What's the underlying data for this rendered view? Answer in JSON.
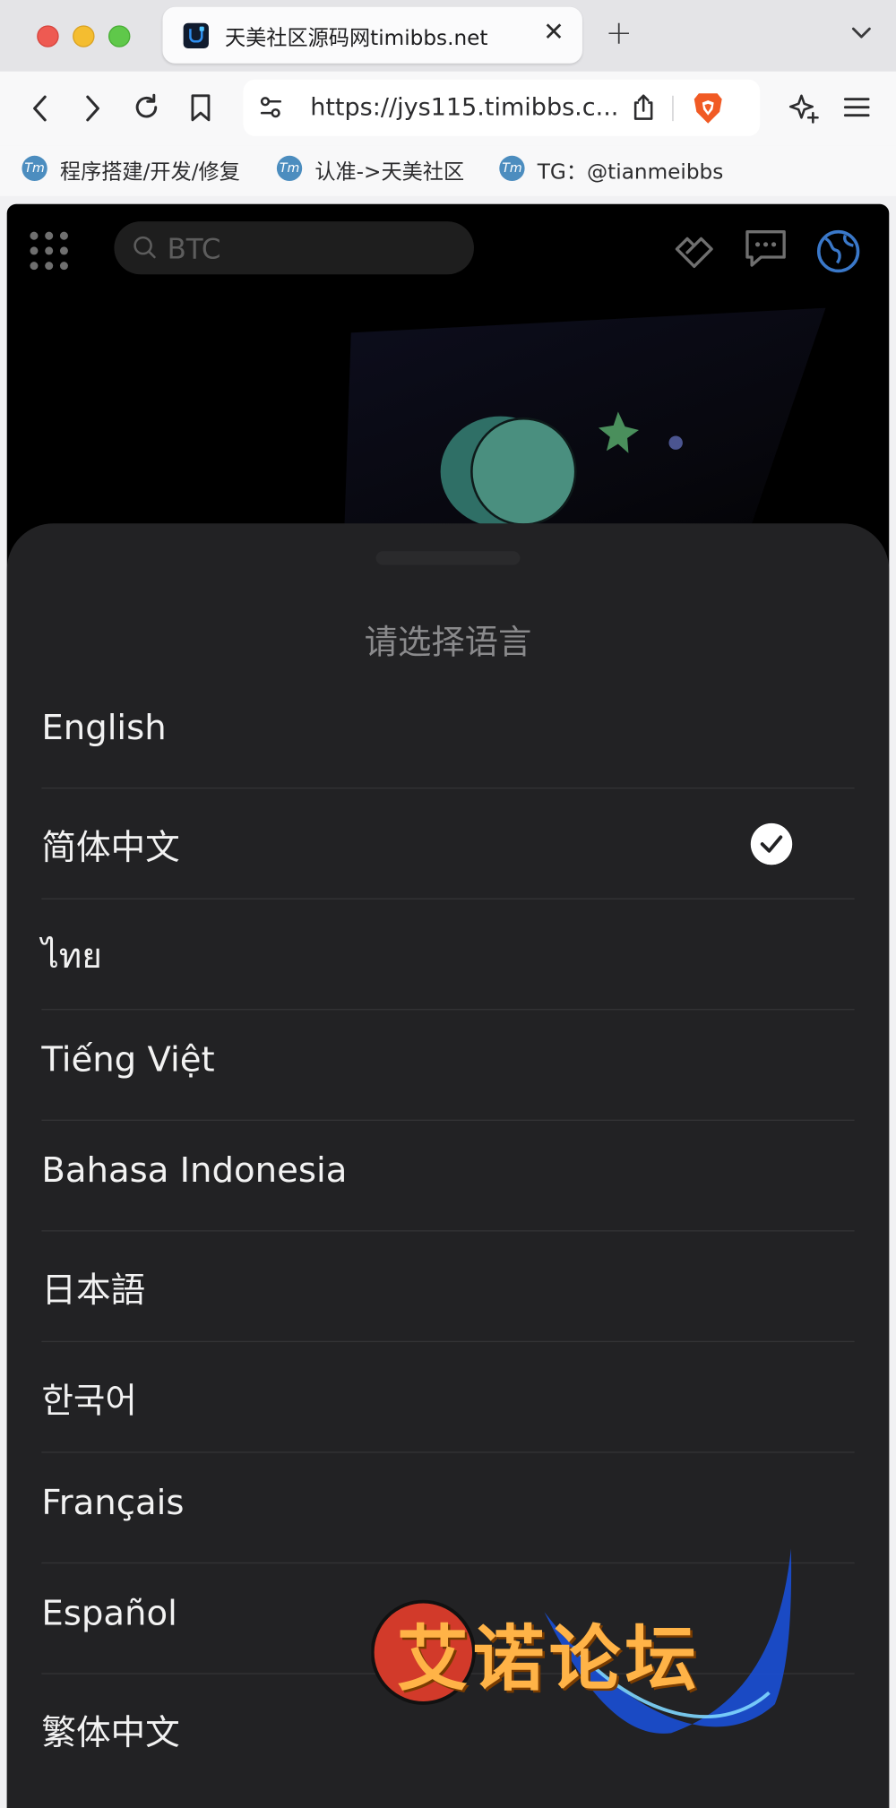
{
  "browser": {
    "tab_title": "天美社区源码网timibbs.net",
    "close_glyph": "✕",
    "new_tab_glyph": "+",
    "url": "https://jys115.timibbs.c..."
  },
  "bookmarks": [
    {
      "icon_text": "Tm",
      "label": "程序搭建/开发/修复"
    },
    {
      "icon_text": "Tm",
      "label": "认准->天美社区"
    },
    {
      "icon_text": "Tm",
      "label": "TG：@tianmeibbs"
    }
  ],
  "page": {
    "search_placeholder": "BTC"
  },
  "language_sheet": {
    "title": "请选择语言",
    "languages": [
      {
        "label": "English",
        "selected": false
      },
      {
        "label": "简体中文",
        "selected": true
      },
      {
        "label": "ไทย",
        "selected": false
      },
      {
        "label": "Tiếng Việt",
        "selected": false
      },
      {
        "label": "Bahasa Indonesia",
        "selected": false
      },
      {
        "label": "日本語",
        "selected": false
      },
      {
        "label": "한국어",
        "selected": false
      },
      {
        "label": "Français",
        "selected": false
      },
      {
        "label": "Español",
        "selected": false
      },
      {
        "label": "繁体中文",
        "selected": false
      }
    ]
  },
  "watermark": {
    "text": "艾诺论坛"
  },
  "colors": {
    "sheet_bg": "#222224",
    "page_bg": "#000000",
    "brave_orange": "#f15a24",
    "accent_green": "#4a8f5c"
  }
}
